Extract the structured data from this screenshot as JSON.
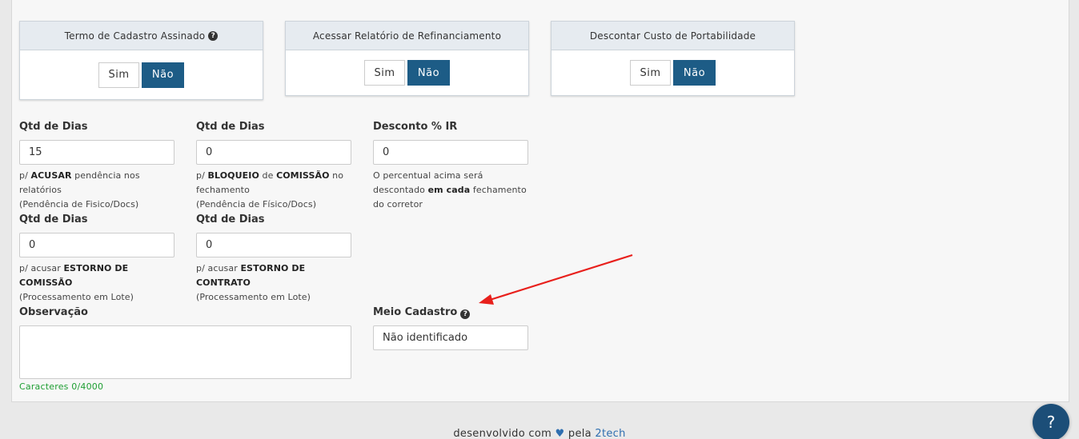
{
  "toggles": [
    {
      "title": "Termo de Cadastro Assinado",
      "has_help": true,
      "option_yes": "Sim",
      "option_no": "Não",
      "selected": "Não"
    },
    {
      "title": "Acessar Relatório de Refinanciamento",
      "has_help": false,
      "option_yes": "Sim",
      "option_no": "Não",
      "selected": "Não"
    },
    {
      "title": "Descontar Custo de Portabilidade",
      "has_help": false,
      "option_yes": "Sim",
      "option_no": "Não",
      "selected": "Não"
    }
  ],
  "fields": {
    "dias_pendencia": {
      "label": "Qtd de Dias",
      "value": "15",
      "help": [
        "p/ ",
        "ACUSAR",
        " pendência nos relatórios",
        "(Pendência de Fisico/Docs)"
      ]
    },
    "dias_bloqueio": {
      "label": "Qtd de Dias",
      "value": "0",
      "help": [
        "p/ ",
        "BLOQUEIO",
        " de ",
        "COMISSÃO",
        " no fechamento",
        "(Pendência de Físico/Docs)"
      ]
    },
    "desconto_ir": {
      "label": "Desconto % IR",
      "value": "0",
      "help": [
        "O percentual acima será descontado ",
        "em cada",
        " fechamento do corretor"
      ]
    },
    "dias_estorno_comissao": {
      "label": "Qtd de Dias",
      "value": "0",
      "help": [
        "p/ acusar ",
        "ESTORNO DE COMISSÃO",
        "(Processamento em Lote)"
      ]
    },
    "dias_estorno_contrato": {
      "label": "Qtd de Dias",
      "value": "0",
      "help": [
        "p/ acusar ",
        "ESTORNO DE CONTRATO",
        "(Processamento em Lote)"
      ]
    },
    "observacao": {
      "label": "Observação",
      "value": "",
      "counter": "Caracteres 0/4000"
    },
    "meio_cadastro": {
      "label": "Meio Cadastro",
      "value": "Não identificado"
    }
  },
  "footer": {
    "text_before": "desenvolvido com",
    "text_after": "pela",
    "brand": "2tech"
  },
  "help_button": {
    "label": "?"
  },
  "colors": {
    "primary": "#1d5c86",
    "annotation_arrow": "#e8201c",
    "counter_green": "#1e9e32"
  }
}
